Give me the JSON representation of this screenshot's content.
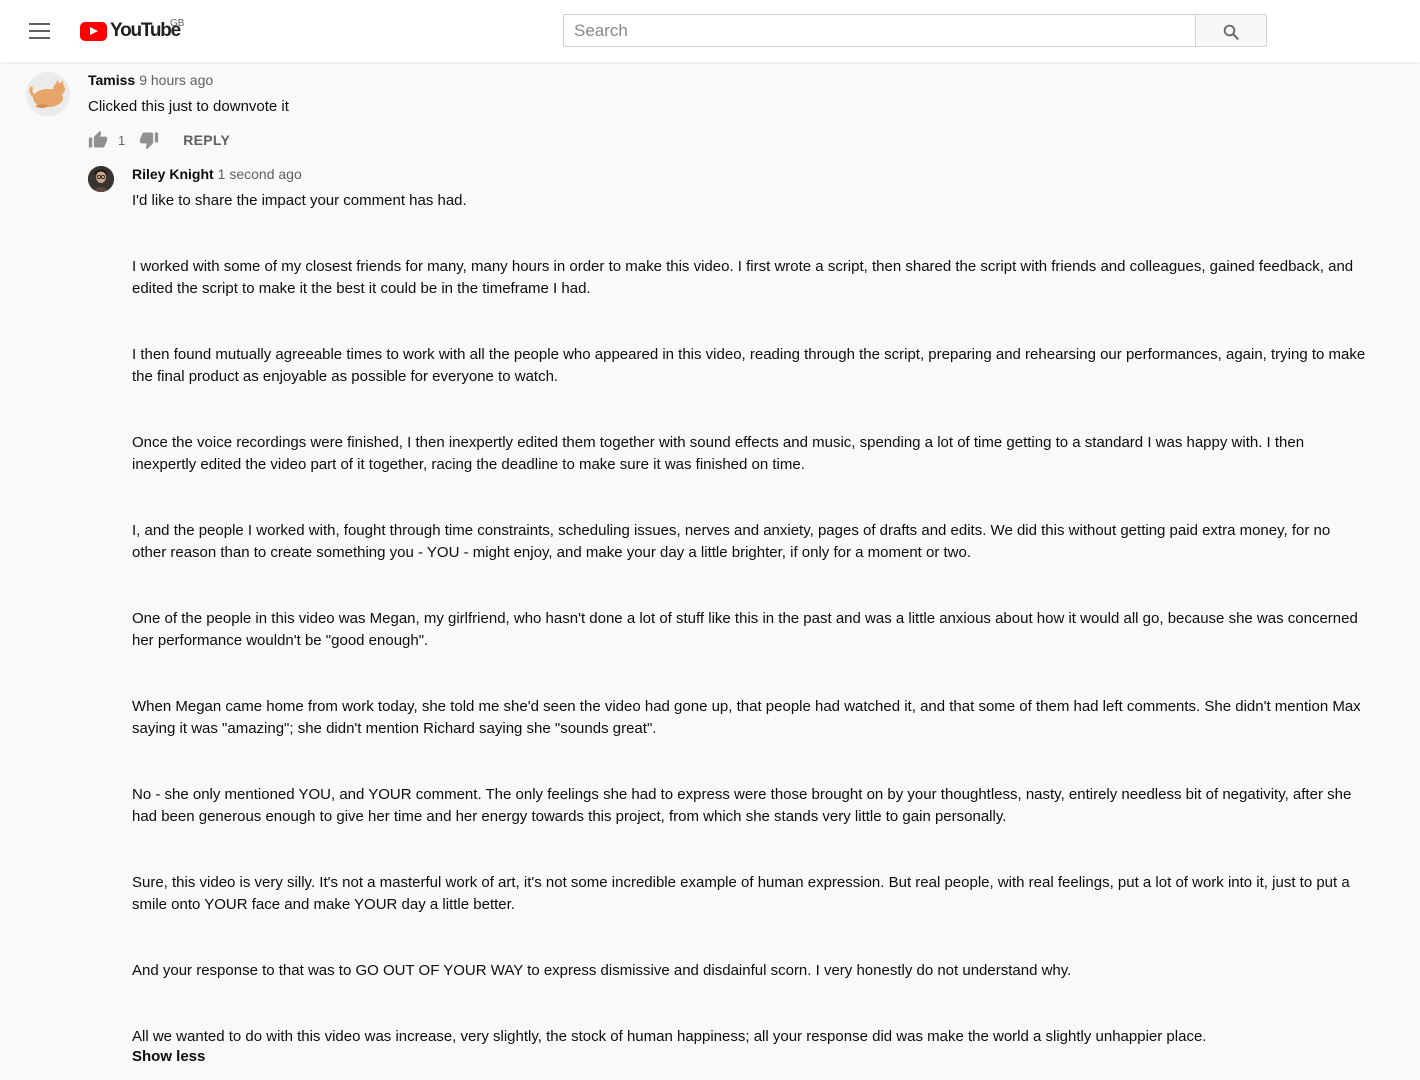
{
  "header": {
    "logo_text": "YouTube",
    "region": "GB",
    "search_placeholder": "Search",
    "colors": {
      "brand_red": "#ff0000",
      "background": "#f9f9f9",
      "masthead": "#ffffff"
    }
  },
  "comment": {
    "author": "Tamiss",
    "time": "9 hours ago",
    "text": "Clicked this just to downvote it",
    "like_count": "1",
    "reply_label": "REPLY",
    "avatar_icon": "cat-avatar"
  },
  "reply": {
    "author": "Riley Knight",
    "time": "1 second ago",
    "avatar_icon": "person-avatar",
    "paragraphs": [
      "I'd like to share the impact your comment has had.",
      "I worked with some of my closest friends for many, many hours in order to make this video. I first wrote a script, then shared the script with friends and colleagues, gained feedback, and edited the script to make it the best it could be in the timeframe I had.",
      "I then found mutually agreeable times to work with all the people who appeared in this video, reading through the script, preparing and rehearsing our performances, again, trying to make the final product as enjoyable as possible for everyone to watch.",
      "Once the voice recordings were finished, I then inexpertly edited them together with sound effects and music, spending a lot of time getting to a standard I was happy with. I then inexpertly edited the video part of it together, racing the deadline to make sure it was finished on time.",
      "I, and the people I worked with, fought through time constraints, scheduling issues, nerves and anxiety, pages of drafts and edits. We did this without getting paid extra money, for no other reason than to create something you - YOU - might enjoy, and make your day a little brighter, if only for a moment or two.",
      "One of the people in this video was Megan, my girlfriend, who hasn't done a lot of stuff like this in the past and was a little anxious about how it would all go, because she was concerned her performance wouldn't be \"good enough\".",
      "When Megan came home from work today, she told me she'd seen the video had gone up, that people had watched it, and that some of them had left comments. She didn't mention Max saying it was \"amazing\"; she didn't mention Richard saying she \"sounds great\".",
      "No - she only mentioned YOU, and YOUR comment. The only feelings she had to express were those brought on by your thoughtless, nasty, entirely needless bit of negativity, after she had been generous enough to give her time and her energy towards this project, from which she stands very little to gain personally.",
      "Sure, this video is very silly. It's not a masterful work of art, it's not some incredible example of human expression. But real people, with real feelings, put a lot of work into it, just to put a smile onto YOUR face and make YOUR day a little better.",
      "And your response to that was to GO OUT OF YOUR WAY to express dismissive and disdainful scorn. I very honestly do not understand why.",
      "All we wanted to do with this video was increase, very slightly, the stock of human happiness; all your response did was make the world a slightly unhappier place."
    ],
    "show_less_label": "Show less"
  }
}
